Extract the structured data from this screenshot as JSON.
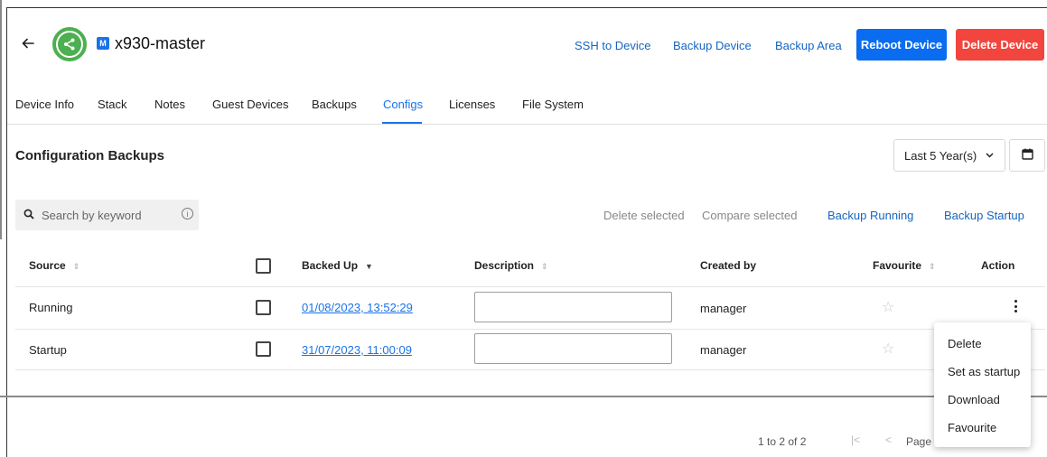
{
  "header": {
    "device_name": "x930-master",
    "device_badge": "M",
    "links": {
      "ssh": "SSH to Device",
      "backup_device": "Backup Device",
      "backup_area": "Backup Area"
    },
    "buttons": {
      "reboot": "Reboot Device",
      "delete": "Delete Device"
    },
    "colors": {
      "primary": "#0a6cf0",
      "danger": "#f1453d",
      "status": "#4caf50"
    }
  },
  "tabs": [
    {
      "label": "Device Info"
    },
    {
      "label": "Stack"
    },
    {
      "label": "Notes"
    },
    {
      "label": "Guest Devices"
    },
    {
      "label": "Backups"
    },
    {
      "label": "Configs",
      "active": true
    },
    {
      "label": "Licenses"
    },
    {
      "label": "File System"
    }
  ],
  "section": {
    "title": "Configuration Backups",
    "range": "Last 5 Year(s)"
  },
  "toolbar": {
    "search_placeholder": "Search by keyword",
    "delete_selected": "Delete selected",
    "compare_selected": "Compare selected",
    "backup_running": "Backup Running",
    "backup_startup": "Backup Startup"
  },
  "table": {
    "columns": {
      "source": "Source",
      "backed_up": "Backed Up",
      "description": "Description",
      "created_by": "Created by",
      "favourite": "Favourite",
      "action": "Action"
    },
    "rows": [
      {
        "source": "Running",
        "backed_up": "01/08/2023, 13:52:29",
        "description": "",
        "created_by": "manager",
        "favourite": false
      },
      {
        "source": "Startup",
        "backed_up": "31/07/2023, 11:00:09",
        "description": "",
        "created_by": "manager",
        "favourite": false
      }
    ]
  },
  "action_menu": {
    "items": [
      "Delete",
      "Set as startup",
      "Download",
      "Favourite"
    ]
  },
  "pagination": {
    "count": "1 to 2 of 2",
    "page_label": "Page"
  },
  "icons": {
    "back": "arrow-left-icon",
    "device": "share-icon",
    "calendar": "calendar-icon",
    "search": "search-icon",
    "info": "info-icon",
    "star": "star-outline-icon",
    "kebab": "more-vertical-icon"
  }
}
